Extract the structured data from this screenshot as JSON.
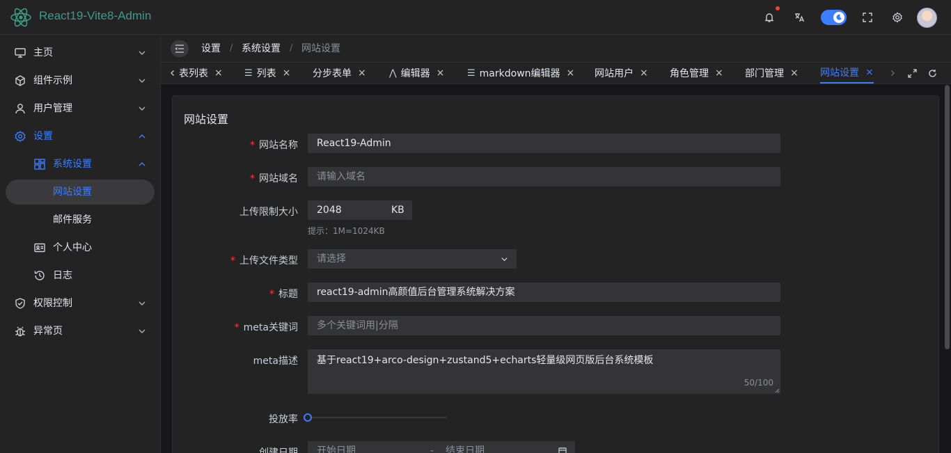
{
  "header": {
    "app_title": "React19-Vite8-Admin"
  },
  "sidebar": {
    "items": [
      {
        "label": "主页"
      },
      {
        "label": "组件示例"
      },
      {
        "label": "用户管理"
      },
      {
        "label": "设置"
      },
      {
        "label": "系统设置"
      },
      {
        "label": "网站设置"
      },
      {
        "label": "邮件服务"
      },
      {
        "label": "个人中心"
      },
      {
        "label": "日志"
      },
      {
        "label": "权限控制"
      },
      {
        "label": "异常页"
      }
    ]
  },
  "breadcrumb": [
    "设置",
    "系统设置",
    "网站设置"
  ],
  "breadcrumb_sep": "/",
  "tabs": [
    {
      "label": "表列表"
    },
    {
      "label": "列表"
    },
    {
      "label": "分步表单"
    },
    {
      "label": "编辑器"
    },
    {
      "label": "markdown编辑器"
    },
    {
      "label": "网站用户"
    },
    {
      "label": "角色管理"
    },
    {
      "label": "部门管理"
    },
    {
      "label": "网站设置"
    }
  ],
  "tab_close": "×",
  "panel": {
    "title": "网站设置",
    "site_name": {
      "label": "网站名称",
      "value": "React19-Admin"
    },
    "domain": {
      "label": "网站域名",
      "placeholder": "请输入域名"
    },
    "upload_limit": {
      "label": "上传限制大小",
      "value": "2048",
      "unit": "KB",
      "hint": "提示：1M=1024KB"
    },
    "file_type": {
      "label": "上传文件类型",
      "placeholder": "请选择"
    },
    "title_field": {
      "label": "标题",
      "value": "react19-admin高颜值后台管理系统解决方案"
    },
    "keywords": {
      "label": "meta关键词",
      "placeholder": "多个关键词用|分隔"
    },
    "description": {
      "label": "meta描述",
      "value": "基于react19+arco-design+zustand5+echarts轻量级网页版后台系统模板",
      "counter": "50/100"
    },
    "rate": {
      "label": "投放率",
      "value": 0
    },
    "date": {
      "label": "创建日期",
      "start_placeholder": "开始日期",
      "sep": "-",
      "end_placeholder": "结束日期"
    }
  },
  "required_mark": "*"
}
